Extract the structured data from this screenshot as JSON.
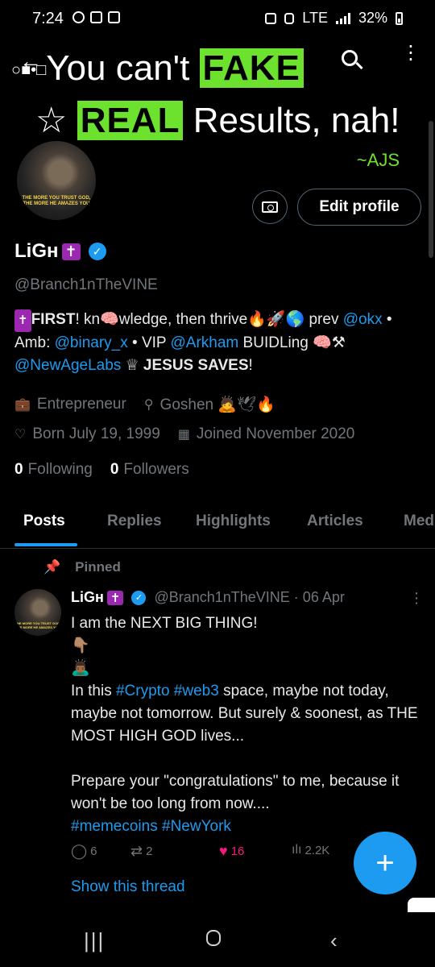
{
  "status_bar": {
    "time": "7:24",
    "network": "LTE",
    "battery": "32%"
  },
  "banner": {
    "prefix_glyphs": "○■•□",
    "line1_text": "You can't ",
    "line1_highlight": "FAKE",
    "line2_star": "☆",
    "line2_highlight": "REAL",
    "line2_text": " Results, nah!",
    "author": "~AJS",
    "highlight_color": "#6ce22f"
  },
  "avatar_caption": "THE MORE YOU TRUST GOD, THE MORE HE AMAZES YOU",
  "buttons": {
    "edit_profile": "Edit profile"
  },
  "profile": {
    "name": "LiGн",
    "name_badge": "✝",
    "handle": "@Branch1nTheVINE",
    "bio": {
      "seg1_badge": "✝",
      "seg1_bold": "FIRST",
      "seg2": "! kn🧠wledge, then thrive🔥🚀🌎 prev ",
      "link1": "@okx",
      "seg3": " • Amb: ",
      "link2": "@binary_x",
      "seg4": " • VIP ",
      "link3": "@Arkham",
      "seg5": "  BUIDLing 🧠⚒ ",
      "link4": "@NewAgeLabs",
      "seg6": " ♕ ",
      "seg6_bold": "JESUS SAVES",
      "seg7": "!"
    },
    "profession": "Entrepreneur",
    "location": "Goshen 🙇🕊🔥",
    "birthday": "Born July 19, 1999",
    "joined": "Joined November 2020",
    "following_count": "0",
    "following_label": "Following",
    "followers_count": "0",
    "followers_label": "Followers"
  },
  "tabs": [
    "Posts",
    "Replies",
    "Highlights",
    "Articles",
    "Med"
  ],
  "pinned_label": "Pinned",
  "tweet": {
    "name": "LiGн",
    "handle_date": "@Branch1nTheVINE · 06 Apr",
    "line1": "I am the NEXT BIG THING!",
    "emoji1": "👇🏽",
    "emoji2": "🙇🏾‍♂️",
    "p2_a": "In this ",
    "p2_tag1": "#Crypto",
    "p2_sp": " ",
    "p2_tag2": "#web3",
    "p2_b": " space, maybe not today, maybe not tomorrow. But surely & soonest, as THE MOST HIGH GOD lives...",
    "p3": "Prepare your \"congratulations\" to me, because it won't be too long from now....",
    "tag3": "#memecoins",
    "tag4": "#NewYork",
    "replies": "6",
    "reposts": "2",
    "likes": "16",
    "views": "2.2K",
    "show_thread": "Show this thread"
  },
  "colors": {
    "accent": "#1d9bf0",
    "like": "#f91880",
    "background": "#000000"
  }
}
